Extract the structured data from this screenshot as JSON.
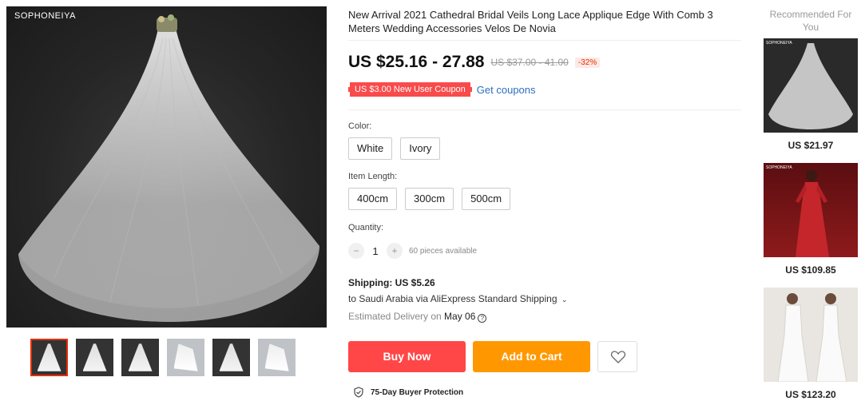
{
  "gallery": {
    "brand": "SOPHONEIYA",
    "thumbnails": [
      "veil-1",
      "veil-2",
      "veil-3",
      "veil-4",
      "veil-5",
      "veil-6"
    ],
    "active_index": 0
  },
  "product": {
    "title": "New Arrival 2021 Cathedral Bridal Veils Long Lace Applique Edge With Comb 3 Meters Wedding Accessories Velos De Novia",
    "price": "US $25.16 - 27.88",
    "original_price": "US $37.00 - 41.00",
    "discount": "-32%",
    "coupon": "US $3.00 New User Coupon",
    "get_coupons": "Get coupons"
  },
  "options": {
    "color_label": "Color:",
    "colors": [
      "White",
      "Ivory"
    ],
    "length_label": "Item Length:",
    "lengths": [
      "400cm",
      "300cm",
      "500cm"
    ],
    "quantity_label": "Quantity:",
    "quantity_minus": "−",
    "quantity_value": "1",
    "quantity_plus": "+",
    "available": "60 pieces available"
  },
  "shipping": {
    "title": "Shipping: US $5.26",
    "destination": "to Saudi Arabia via AliExpress Standard Shipping",
    "delivery_prefix": "Estimated Delivery on ",
    "delivery_date": "May 06"
  },
  "actions": {
    "buy_now": "Buy Now",
    "add_to_cart": "Add to Cart",
    "protection": "75-Day Buyer Protection"
  },
  "recommended": {
    "title": "Recommended For You",
    "tag": "SOPHONEIYA",
    "items": [
      {
        "price": "US $21.97"
      },
      {
        "price": "US $109.85"
      },
      {
        "price": "US $123.20"
      }
    ]
  },
  "colors": {
    "buy_now": "#ff4747",
    "add_to_cart": "#ff9800",
    "coupon": "#f94b4b",
    "link": "#2f6fbd"
  }
}
